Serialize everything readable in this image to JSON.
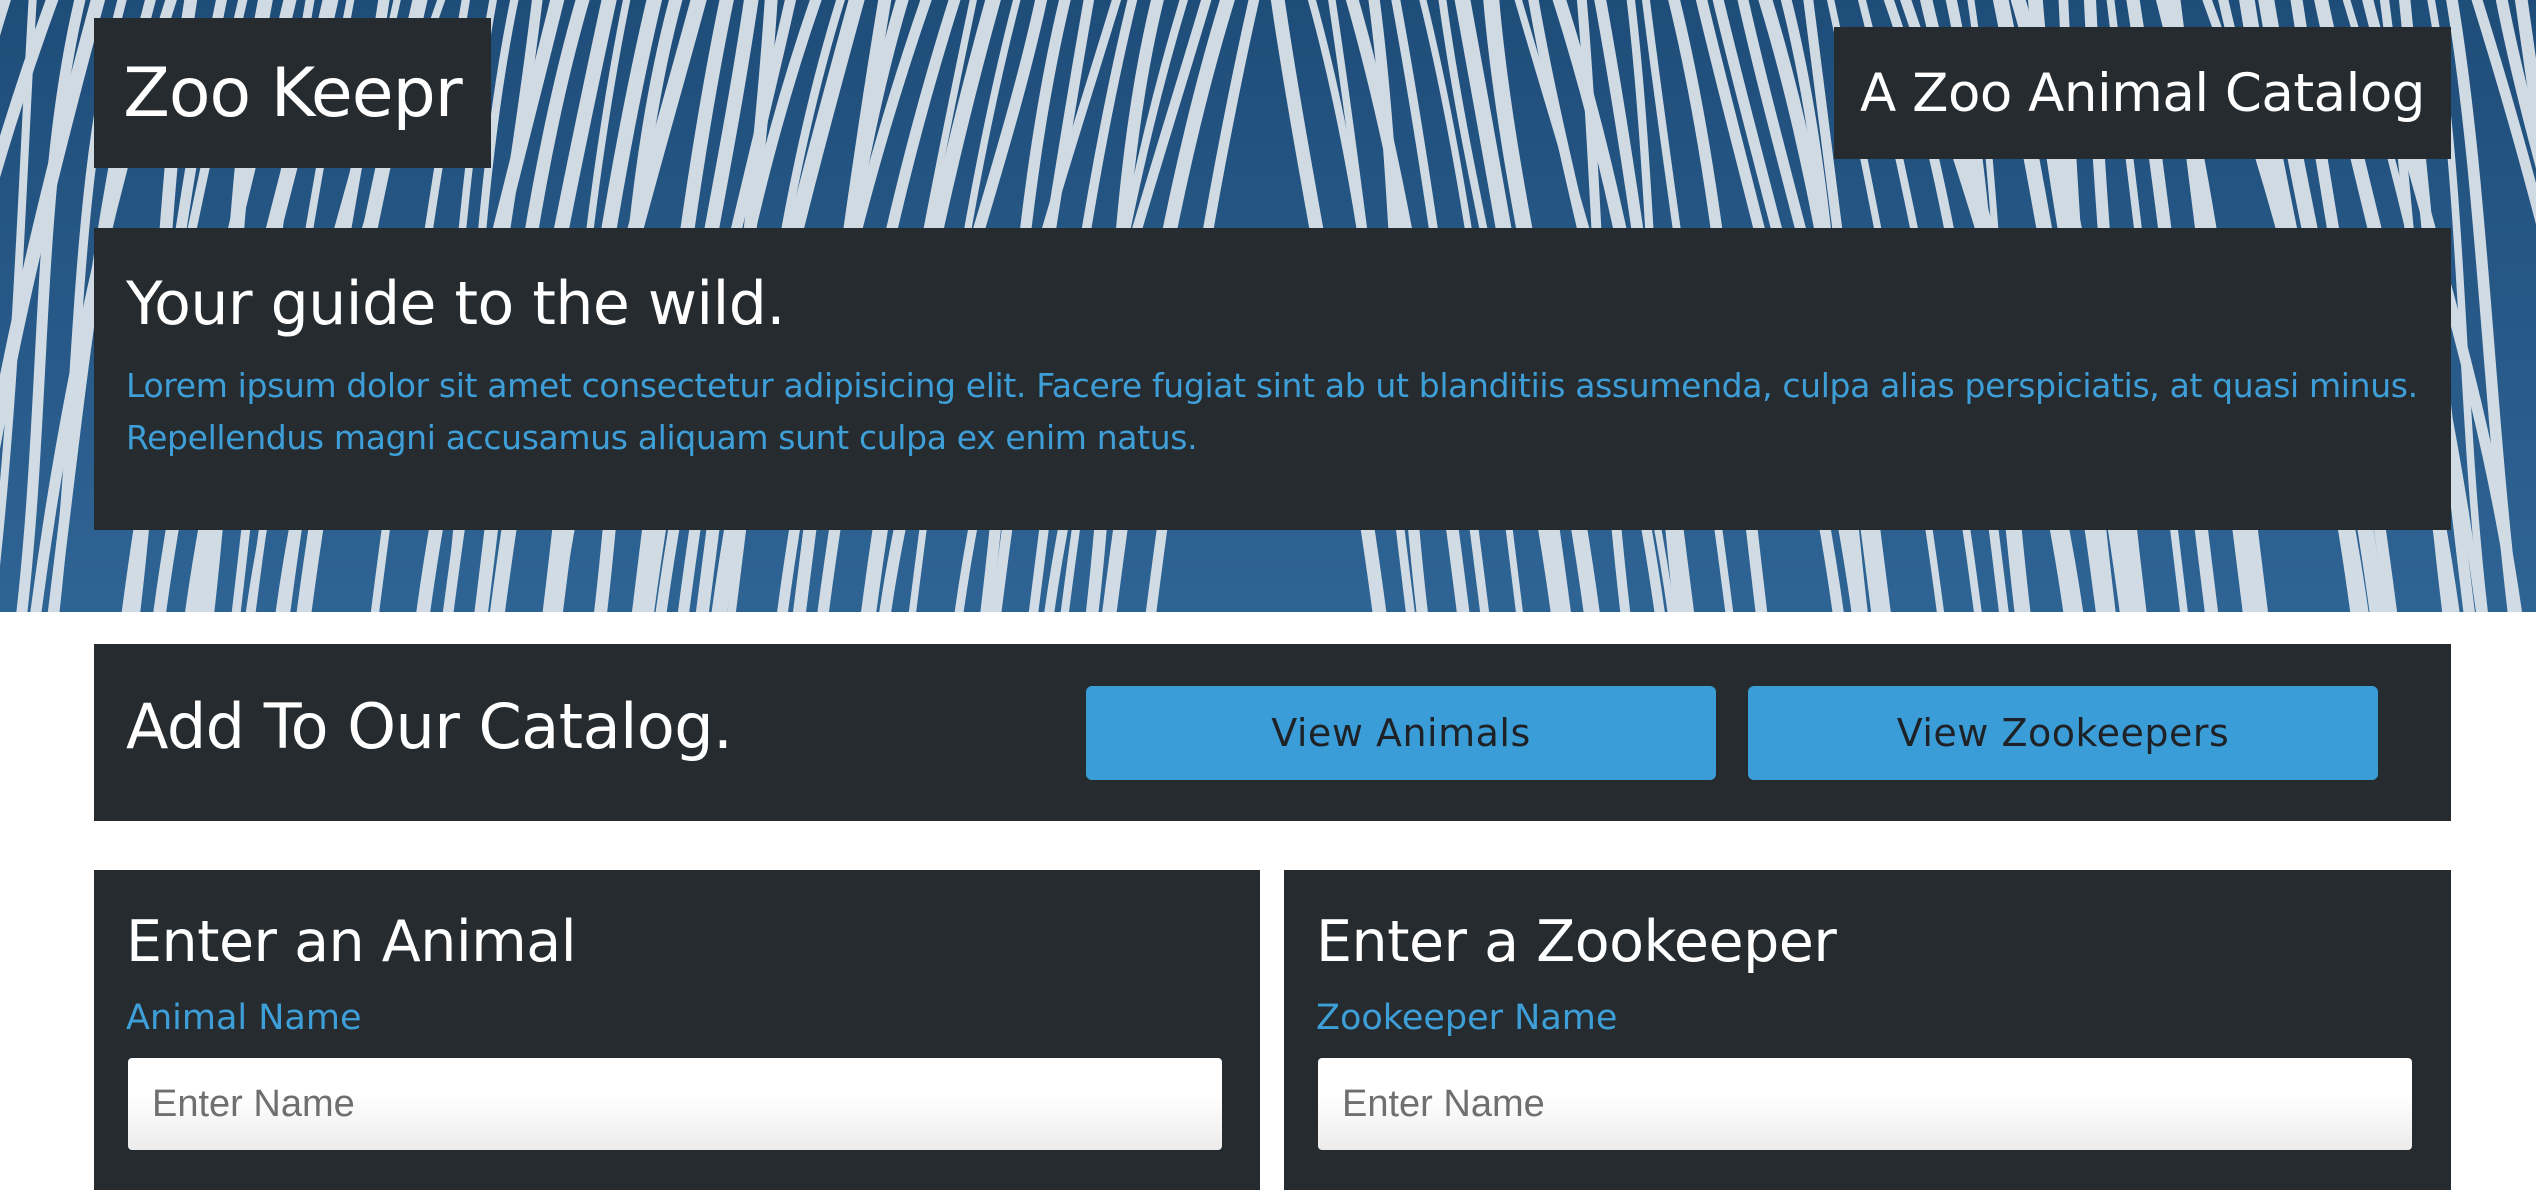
{
  "header": {
    "brand": "Zoo Keepr",
    "tagline": "A Zoo Animal Catalog"
  },
  "intro": {
    "heading": "Your guide to the wild.",
    "body": "Lorem ipsum dolor sit amet consectetur adipisicing elit. Facere fugiat sint ab ut blanditiis assumenda, culpa alias perspiciatis, at quasi minus. Repellendus magni accusamus aliquam sunt culpa ex enim natus."
  },
  "catalog": {
    "heading": "Add To Our Catalog.",
    "view_animals_label": "View Animals",
    "view_zookeepers_label": "View Zookeepers"
  },
  "animal_form": {
    "heading": "Enter an Animal",
    "name_label": "Animal Name",
    "name_placeholder": "Enter Name",
    "name_value": ""
  },
  "zookeeper_form": {
    "heading": "Enter a Zookeeper",
    "name_label": "Zookeeper Name",
    "name_placeholder": "Enter Name",
    "name_value": ""
  },
  "colors": {
    "panel": "#262b2f",
    "accent": "#3b9dd8",
    "hero_blue": "#2a5a86"
  }
}
